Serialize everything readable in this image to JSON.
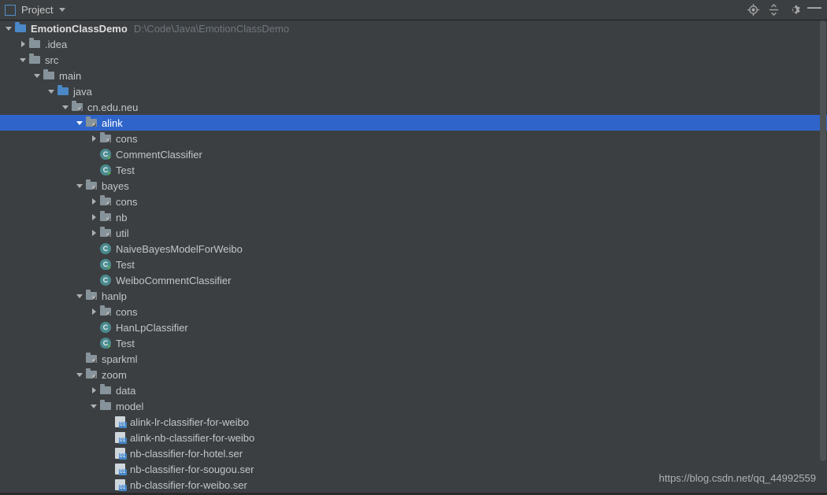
{
  "toolbar": {
    "title": "Project"
  },
  "watermark": "https://blog.csdn.net/qq_44992559",
  "tree": [
    {
      "depth": 0,
      "expand": "open",
      "icon": "module",
      "label": "EmotionClassDemo",
      "bold": true,
      "tail": "D:\\Code\\Java\\EmotionClassDemo",
      "selected": false
    },
    {
      "depth": 1,
      "expand": "closed",
      "icon": "folder",
      "label": ".idea",
      "selected": false
    },
    {
      "depth": 1,
      "expand": "open",
      "icon": "folder",
      "label": "src",
      "selected": false
    },
    {
      "depth": 2,
      "expand": "open",
      "icon": "folder",
      "label": "main",
      "selected": false
    },
    {
      "depth": 3,
      "expand": "open",
      "icon": "source",
      "label": "java",
      "selected": false
    },
    {
      "depth": 4,
      "expand": "open",
      "icon": "pkg",
      "label": "cn.edu.neu",
      "selected": false
    },
    {
      "depth": 5,
      "expand": "open",
      "icon": "pkg",
      "label": "alink",
      "selected": true
    },
    {
      "depth": 6,
      "expand": "closed",
      "icon": "pkg",
      "label": "cons",
      "selected": false
    },
    {
      "depth": 6,
      "expand": "none",
      "icon": "class-run",
      "label": "CommentClassifier",
      "selected": false
    },
    {
      "depth": 6,
      "expand": "none",
      "icon": "class-run",
      "label": "Test",
      "selected": false
    },
    {
      "depth": 5,
      "expand": "open",
      "icon": "pkg",
      "label": "bayes",
      "selected": false
    },
    {
      "depth": 6,
      "expand": "closed",
      "icon": "pkg",
      "label": "cons",
      "selected": false
    },
    {
      "depth": 6,
      "expand": "closed",
      "icon": "pkg",
      "label": "nb",
      "selected": false
    },
    {
      "depth": 6,
      "expand": "closed",
      "icon": "pkg",
      "label": "util",
      "selected": false
    },
    {
      "depth": 6,
      "expand": "none",
      "icon": "class",
      "label": "NaiveBayesModelForWeibo",
      "selected": false
    },
    {
      "depth": 6,
      "expand": "none",
      "icon": "class-run",
      "label": "Test",
      "selected": false
    },
    {
      "depth": 6,
      "expand": "none",
      "icon": "class",
      "label": "WeiboCommentClassifier",
      "selected": false
    },
    {
      "depth": 5,
      "expand": "open",
      "icon": "pkg",
      "label": "hanlp",
      "selected": false
    },
    {
      "depth": 6,
      "expand": "closed",
      "icon": "pkg",
      "label": "cons",
      "selected": false
    },
    {
      "depth": 6,
      "expand": "none",
      "icon": "class",
      "label": "HanLpClassifier",
      "selected": false
    },
    {
      "depth": 6,
      "expand": "none",
      "icon": "class-run",
      "label": "Test",
      "selected": false
    },
    {
      "depth": 5,
      "expand": "none",
      "icon": "pkg",
      "label": "sparkml",
      "selected": false
    },
    {
      "depth": 5,
      "expand": "open",
      "icon": "pkg",
      "label": "zoom",
      "selected": false
    },
    {
      "depth": 6,
      "expand": "closed",
      "icon": "folder",
      "label": "data",
      "selected": false
    },
    {
      "depth": 6,
      "expand": "open",
      "icon": "folder",
      "label": "model",
      "selected": false
    },
    {
      "depth": 7,
      "expand": "none",
      "icon": "ser",
      "label": "alink-lr-classifier-for-weibo",
      "selected": false
    },
    {
      "depth": 7,
      "expand": "none",
      "icon": "ser",
      "label": "alink-nb-classifier-for-weibo",
      "selected": false
    },
    {
      "depth": 7,
      "expand": "none",
      "icon": "ser",
      "label": "nb-classifier-for-hotel.ser",
      "selected": false
    },
    {
      "depth": 7,
      "expand": "none",
      "icon": "ser",
      "label": "nb-classifier-for-sougou.ser",
      "selected": false
    },
    {
      "depth": 7,
      "expand": "none",
      "icon": "ser",
      "label": "nb-classifier-for-weibo.ser",
      "selected": false
    }
  ]
}
